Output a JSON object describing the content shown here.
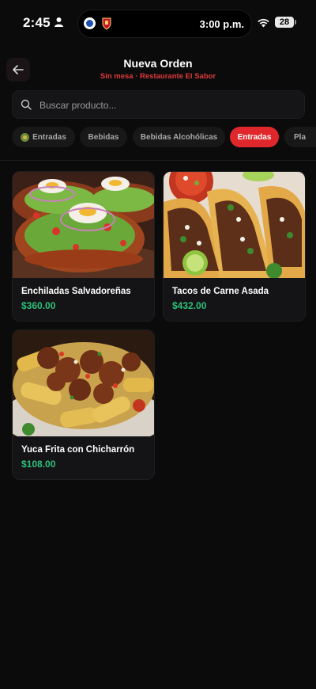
{
  "status_bar": {
    "time": "2:45",
    "island_time": "3:00 p.m.",
    "battery": "28"
  },
  "header": {
    "title": "Nueva Orden",
    "subtitle": "Sin mesa · Restaurante El Sabor"
  },
  "search": {
    "placeholder": "Buscar producto..."
  },
  "categories": [
    {
      "label": "Entradas",
      "active": false
    },
    {
      "label": "Bebidas",
      "active": false
    },
    {
      "label": "Bebidas Alcohólicas",
      "active": false
    },
    {
      "label": "Entradas",
      "active": true
    },
    {
      "label": "Pla",
      "active": false
    }
  ],
  "products": [
    {
      "name": "Enchiladas Salvadoreñas",
      "price": "$360.00"
    },
    {
      "name": "Tacos de Carne Asada",
      "price": "$432.00"
    },
    {
      "name": "Yuca Frita con Chicharrón",
      "price": "$108.00"
    }
  ],
  "colors": {
    "accent": "#e0272c",
    "price": "#2ec07a",
    "background": "#0b0b0c"
  }
}
